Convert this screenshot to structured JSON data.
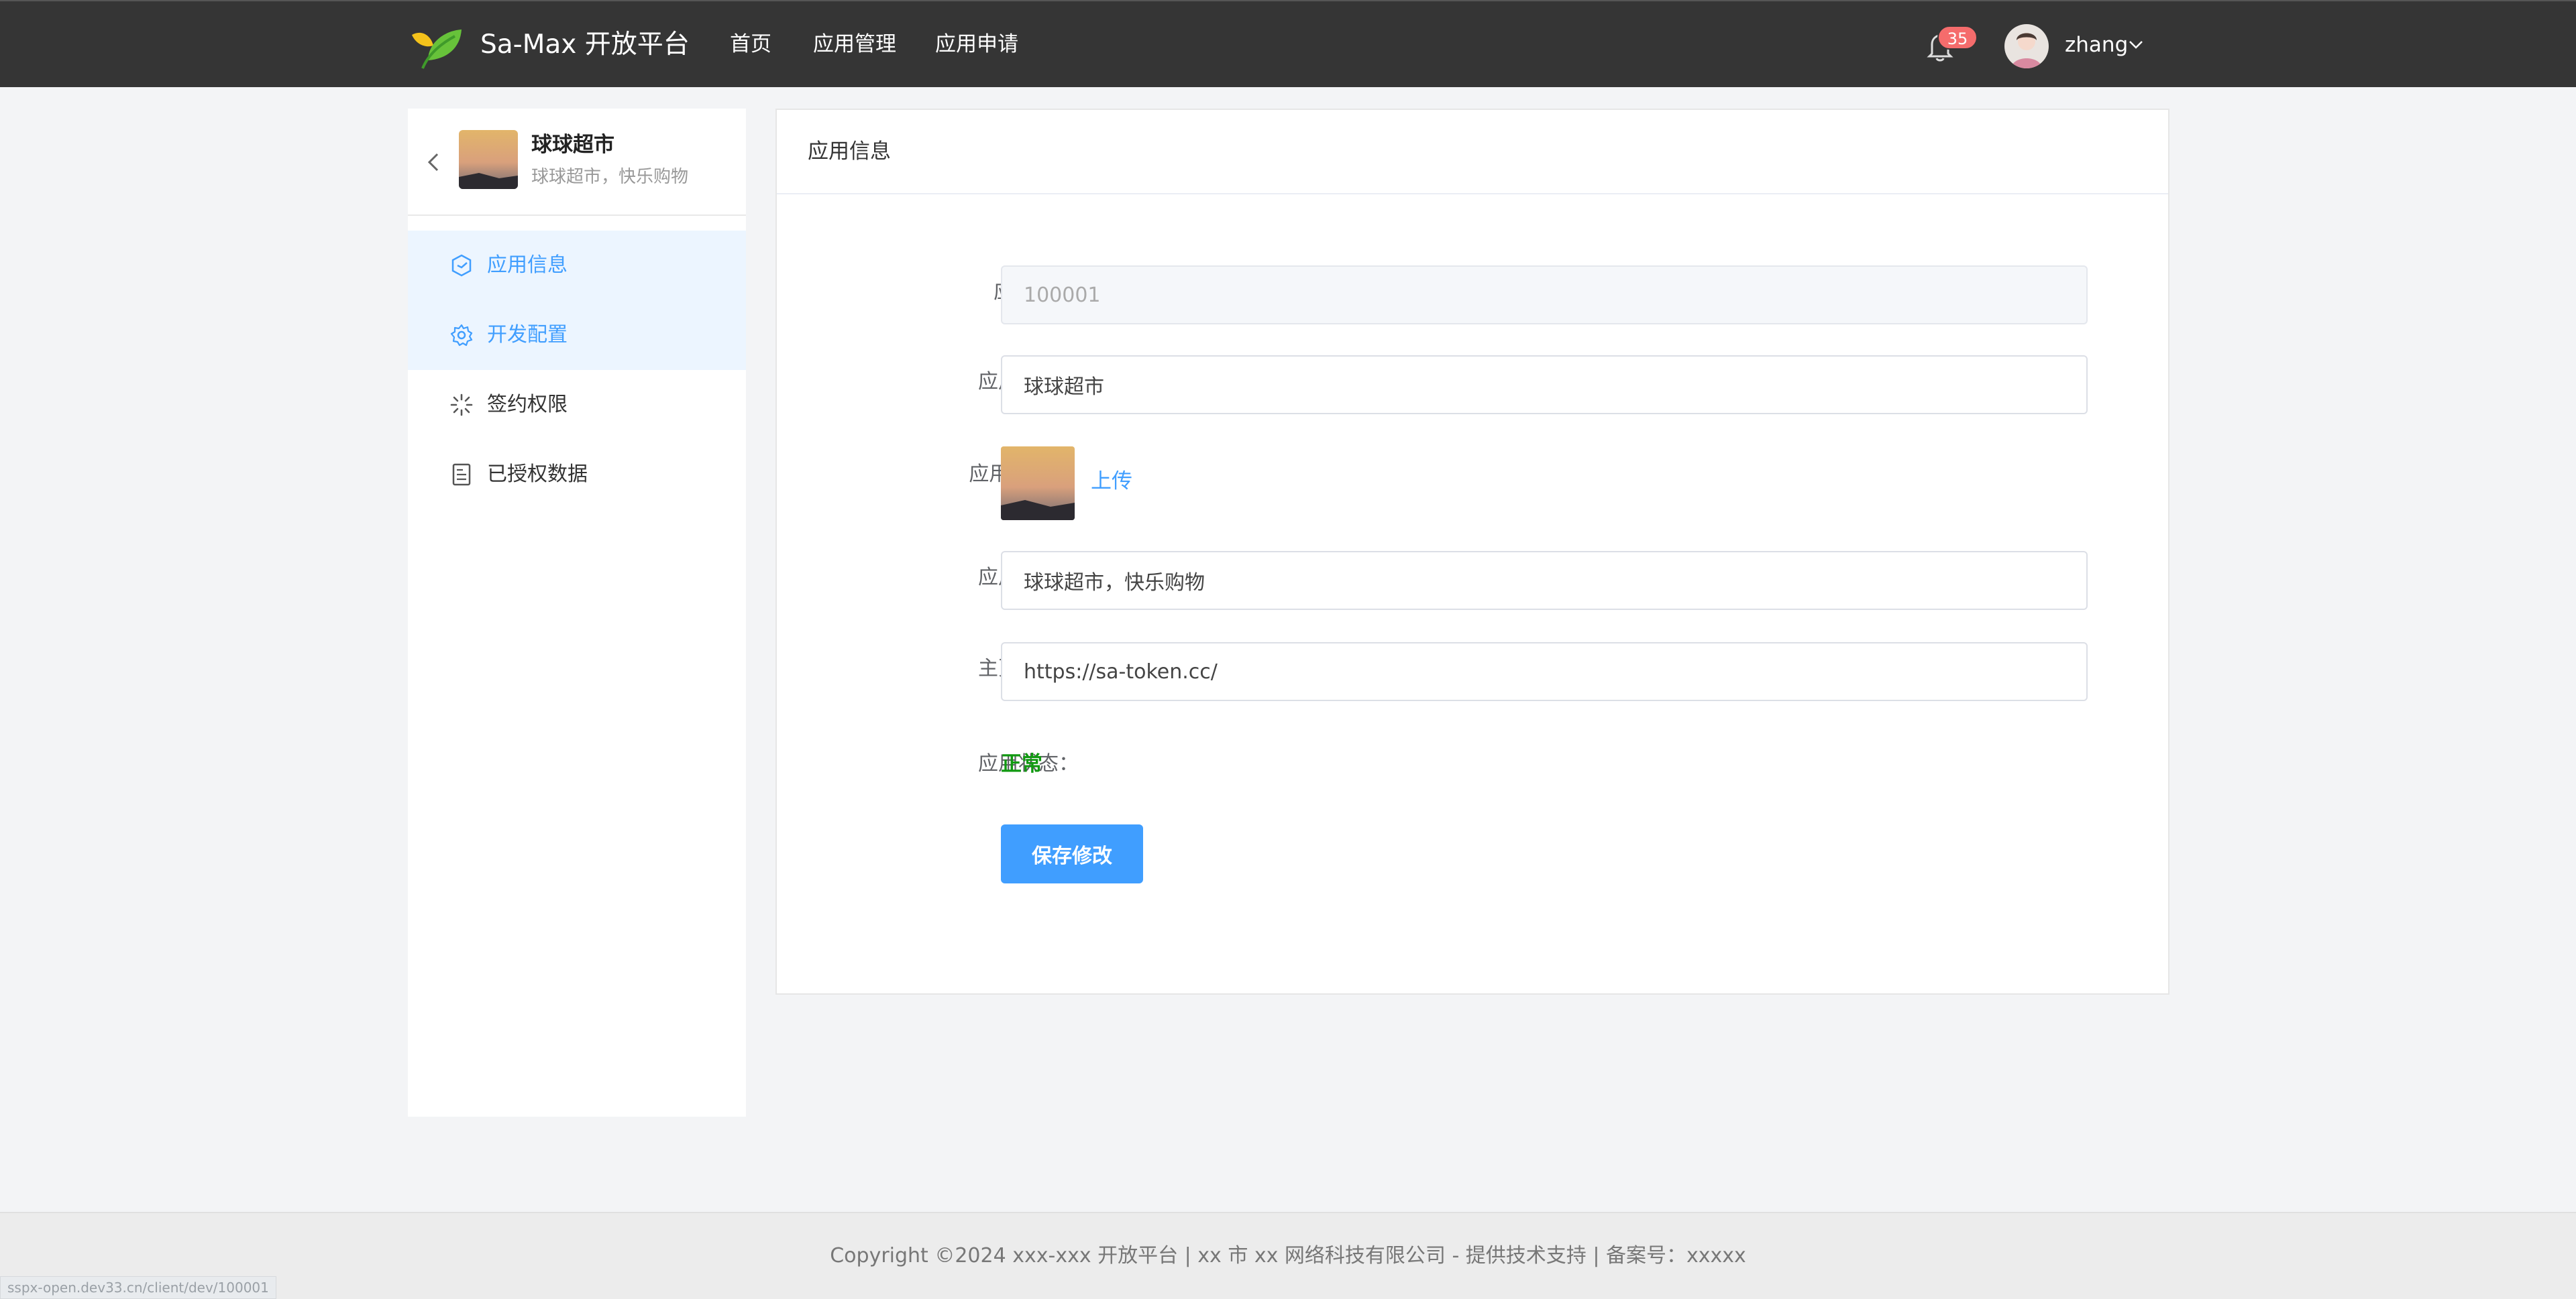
{
  "header": {
    "brand": "Sa-Max 开放平台",
    "nav": [
      "首页",
      "应用管理",
      "应用申请"
    ],
    "notification_count": "35",
    "username": "zhang"
  },
  "sidebar": {
    "app_name": "球球超市",
    "app_desc": "球球超市，快乐购物",
    "items": [
      {
        "label": "应用信息",
        "icon": "app-info-icon",
        "active": true
      },
      {
        "label": "开发配置",
        "icon": "gear-icon",
        "active": true
      },
      {
        "label": "签约权限",
        "icon": "loading-icon",
        "active": false
      },
      {
        "label": "已授权数据",
        "icon": "document-icon",
        "active": false
      }
    ]
  },
  "main": {
    "card_title": "应用信息",
    "form": {
      "app_id_label": "应用 id：",
      "app_id_value": "100001",
      "app_name_label": "应用名称：",
      "app_name_value": "球球超市",
      "app_logo_label": "应用 logo：",
      "upload_label": "上传",
      "app_intro_label": "应用介绍：",
      "app_intro_value": "球球超市，快乐购物",
      "homepage_label": "主页地址：",
      "homepage_value": "https://sa-token.cc/",
      "status_label": "应用状态：",
      "status_value": "正常",
      "save_label": "保存修改"
    }
  },
  "footer": {
    "copyright": "Copyright ©2024 xxx-xxx 开放平台 | xx 市 xx 网络科技有限公司 - 提供技术支持 | 备案号：xxxxx"
  },
  "status_bar_url": "sspx-open.dev33.cn/client/dev/100001",
  "colors": {
    "header_bg": "#353535",
    "accent": "#409eff",
    "active_menu_bg": "#ecf5ff",
    "status_ok": "#119911",
    "badge": "#f56c6c"
  }
}
